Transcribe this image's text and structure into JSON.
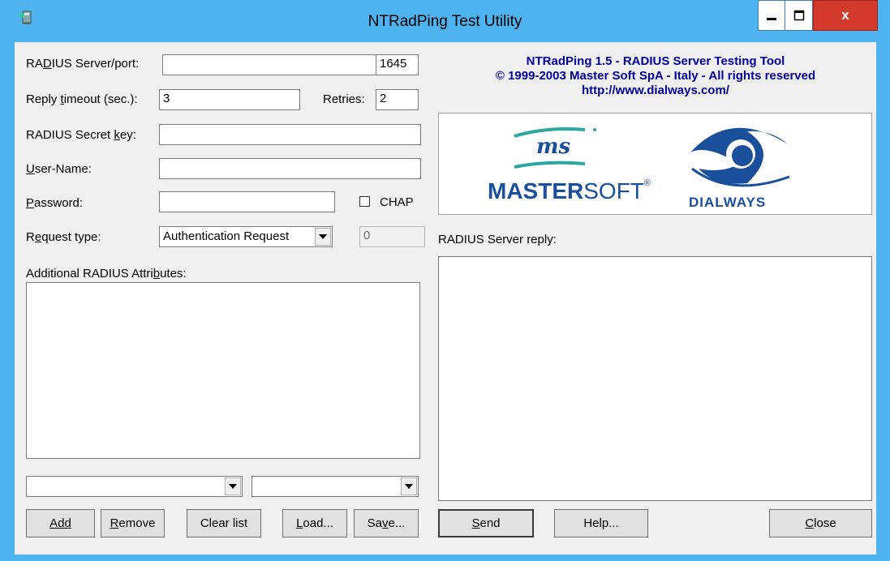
{
  "window": {
    "title": "NTRadPing Test Utility",
    "close_glyph": "x"
  },
  "form": {
    "server_label": "RADIUS Server/port:",
    "server_value": "",
    "port_value": "1645",
    "timeout_label": "Reply timeout (sec.):",
    "timeout_value": "3",
    "retries_label": "Retries:",
    "retries_value": "2",
    "secret_label": "RADIUS Secret key:",
    "secret_value": "",
    "username_label": "User-Name:",
    "username_value": "",
    "password_label": "Password:",
    "password_value": "",
    "chap_label": "CHAP",
    "chap_checked": false,
    "request_label": "Request type:",
    "request_value": "Authentication Request",
    "request_extra_value": "0",
    "attributes_label": "Additional RADIUS Attributes:",
    "attr_select_1": "",
    "attr_select_2": ""
  },
  "header": {
    "line1": "NTRadPing 1.5 - RADIUS Server Testing Tool",
    "line2": "© 1999-2003 Master Soft SpA - Italy - All rights reserved",
    "line3": "http://www.dialways.com/"
  },
  "logos": {
    "mastersoft_ms": "ms",
    "mastersoft_master": "MASTER",
    "mastersoft_soft": "SOFT",
    "dialways": "DIALWAYS"
  },
  "reply": {
    "label": "RADIUS Server reply:"
  },
  "buttons": {
    "add": "Add",
    "remove": "Remove",
    "clear": "Clear list",
    "load": "Load...",
    "save": "Save...",
    "send": "Send",
    "help": "Help...",
    "close": "Close"
  },
  "colors": {
    "frame": "#4fb3ef",
    "header_text": "#000099",
    "close_button": "#d33a2c",
    "mastersoft_blue": "#1a4f9c",
    "mastersoft_teal": "#2aa8a0"
  }
}
